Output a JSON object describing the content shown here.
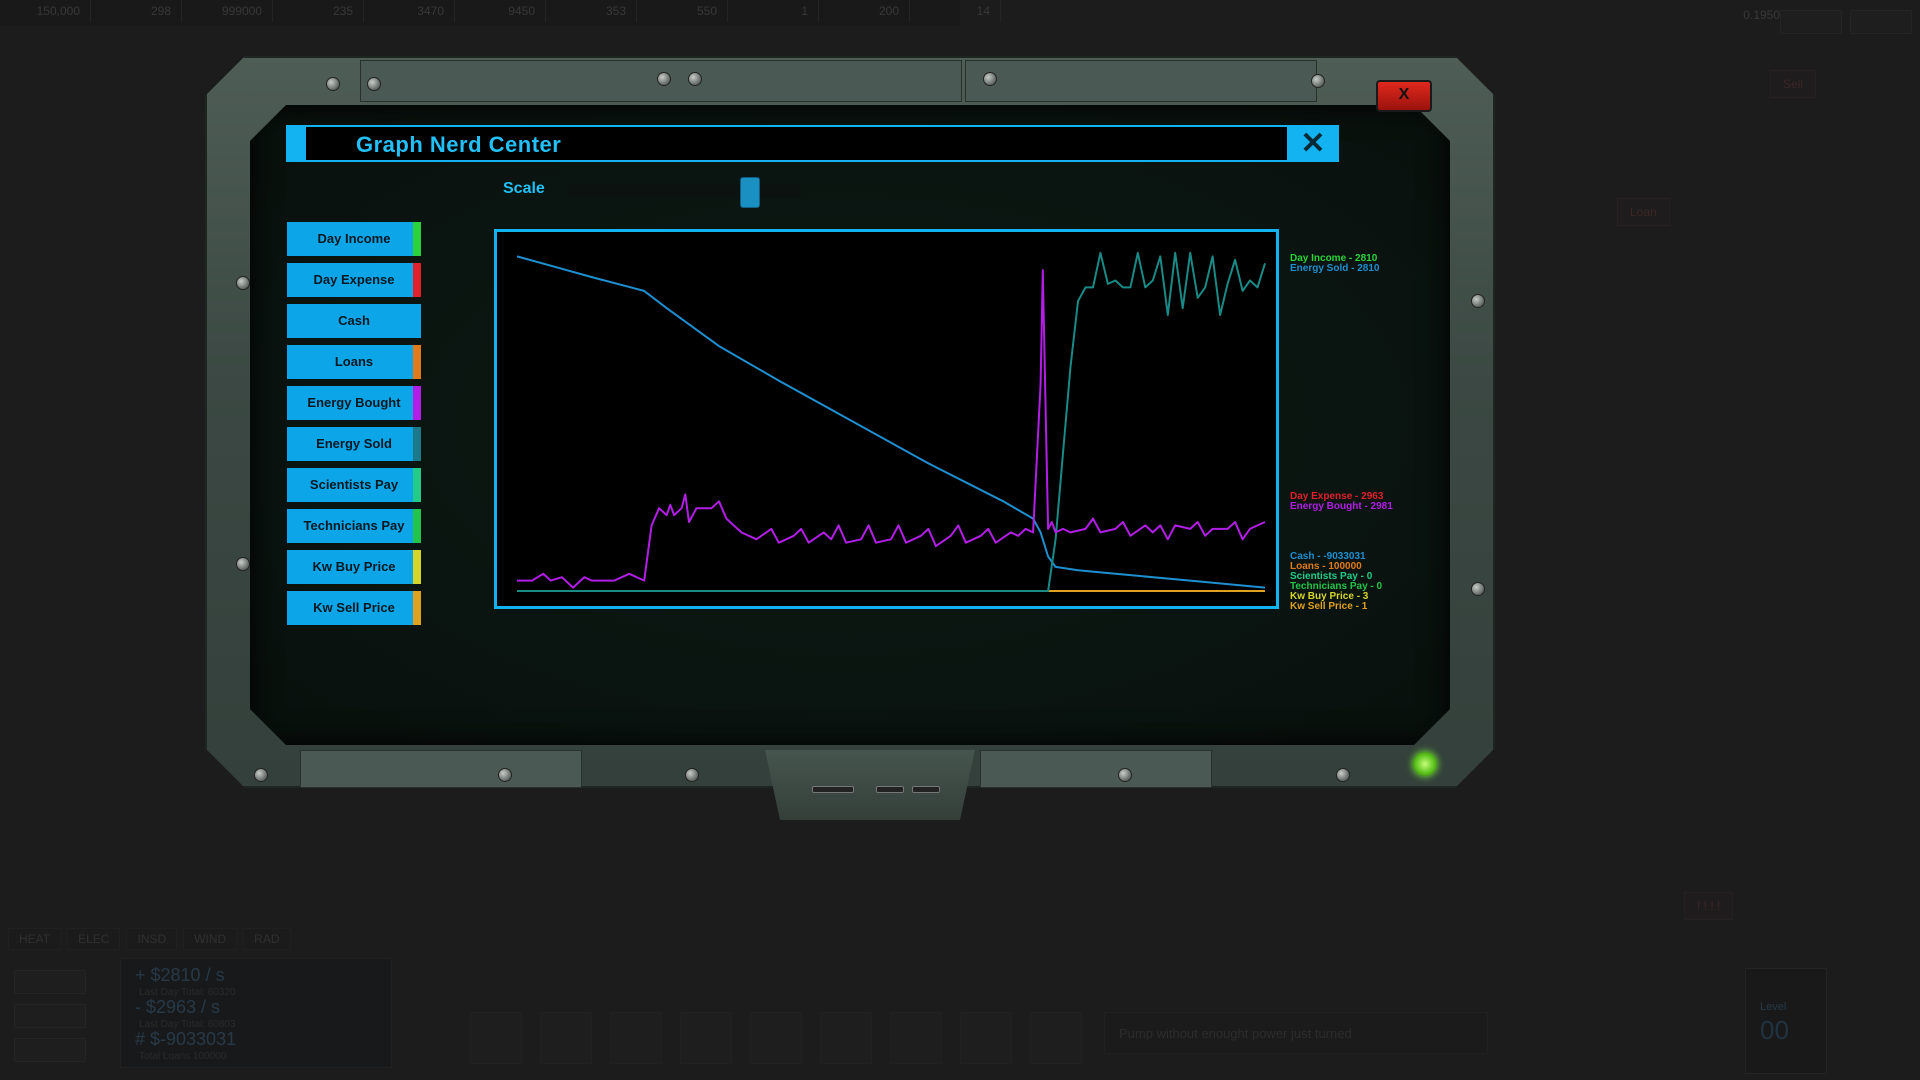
{
  "background": {
    "top_stats": [
      "150,000",
      "298",
      "999000",
      "235",
      "3470",
      "9450",
      "353",
      "550",
      "1",
      "200",
      "14"
    ],
    "bg_chips": [
      "Sell",
      "Loan",
      "! ! ! !"
    ],
    "bottom_tabs": [
      "HEAT",
      "ELEC",
      "INSD",
      "WIND",
      "RAD"
    ],
    "money": {
      "income": "+ $2810 / s",
      "income_sub": "Last Day Total: 60320",
      "expense": "- $2963 / s",
      "expense_sub": "Last Day Total: 60803",
      "cash": "# $-9033031",
      "loans_sub": "Total Loans 100000"
    },
    "message": "Pump without enought power just turned",
    "level_label": "Level",
    "level_value": "00",
    "top_right_value": "0.1950"
  },
  "window": {
    "title": "Graph Nerd Center",
    "close_icon": "x-icon",
    "frame_close_label": "X",
    "scale_label": "Scale",
    "scale_value": 0.78
  },
  "series_buttons": [
    {
      "label": "Day Income",
      "color": "#2ad33a"
    },
    {
      "label": "Day Expense",
      "color": "#e0202a"
    },
    {
      "label": "Cash",
      "color": "#0ca6e8"
    },
    {
      "label": "Loans",
      "color": "#e07a1a"
    },
    {
      "label": "Energy Bought",
      "color": "#b21ee6"
    },
    {
      "label": "Energy Sold",
      "color": "#1a7a8a"
    },
    {
      "label": "Scientists Pay",
      "color": "#22cc88"
    },
    {
      "label": "Technicians Pay",
      "color": "#22c44a"
    },
    {
      "label": "Kw Buy Price",
      "color": "#d6d62a"
    },
    {
      "label": "Kw Sell Price",
      "color": "#e0a020"
    }
  ],
  "legend": [
    {
      "text": "Day Income - 2810",
      "color": "#2ad33a",
      "group": 0
    },
    {
      "text": "Energy Sold - 2810",
      "color": "#1e8fd0",
      "group": 0
    },
    {
      "text": "Day Expense - 2963",
      "color": "#e0202a",
      "group": 1
    },
    {
      "text": "Energy Bought - 2981",
      "color": "#b21ee6",
      "group": 1
    },
    {
      "text": "Cash - -9033031",
      "color": "#1e8fd0",
      "group": 2
    },
    {
      "text": "Loans - 100000",
      "color": "#e07a1a",
      "group": 2
    },
    {
      "text": "Scientists Pay - 0",
      "color": "#22cc88",
      "group": 2
    },
    {
      "text": "Technicians Pay - 0",
      "color": "#22c44a",
      "group": 2
    },
    {
      "text": "Kw Buy Price - 3",
      "color": "#d6d62a",
      "group": 2
    },
    {
      "text": "Kw Sell Price - 1",
      "color": "#e0a020",
      "group": 2
    }
  ],
  "chart_data": {
    "type": "line",
    "title": "",
    "xlabel": "",
    "ylabel": "",
    "grid": false,
    "series": [
      {
        "name": "Cash",
        "color": "#1e8fd0",
        "points": [
          [
            0,
            0.97
          ],
          [
            0.05,
            0.94
          ],
          [
            0.1,
            0.91
          ],
          [
            0.17,
            0.87
          ],
          [
            0.2,
            0.82
          ],
          [
            0.27,
            0.71
          ],
          [
            0.35,
            0.61
          ],
          [
            0.45,
            0.49
          ],
          [
            0.55,
            0.37
          ],
          [
            0.65,
            0.26
          ],
          [
            0.69,
            0.21
          ],
          [
            0.7,
            0.17
          ],
          [
            0.71,
            0.1
          ],
          [
            0.72,
            0.07
          ],
          [
            0.75,
            0.06
          ],
          [
            0.8,
            0.05
          ],
          [
            0.9,
            0.03
          ],
          [
            1,
            0.01
          ]
        ]
      },
      {
        "name": "Energy Bought",
        "color": "#b21ee6",
        "points": [
          [
            0,
            0.03
          ],
          [
            0.02,
            0.03
          ],
          [
            0.035,
            0.05
          ],
          [
            0.045,
            0.03
          ],
          [
            0.06,
            0.04
          ],
          [
            0.075,
            0.01
          ],
          [
            0.09,
            0.04
          ],
          [
            0.1,
            0.03
          ],
          [
            0.13,
            0.03
          ],
          [
            0.15,
            0.05
          ],
          [
            0.17,
            0.03
          ],
          [
            0.18,
            0.19
          ],
          [
            0.19,
            0.24
          ],
          [
            0.2,
            0.22
          ],
          [
            0.205,
            0.25
          ],
          [
            0.21,
            0.22
          ],
          [
            0.22,
            0.24
          ],
          [
            0.225,
            0.28
          ],
          [
            0.23,
            0.2
          ],
          [
            0.24,
            0.24
          ],
          [
            0.26,
            0.24
          ],
          [
            0.27,
            0.26
          ],
          [
            0.28,
            0.21
          ],
          [
            0.3,
            0.17
          ],
          [
            0.32,
            0.15
          ],
          [
            0.34,
            0.18
          ],
          [
            0.35,
            0.14
          ],
          [
            0.37,
            0.16
          ],
          [
            0.38,
            0.18
          ],
          [
            0.39,
            0.14
          ],
          [
            0.41,
            0.17
          ],
          [
            0.42,
            0.15
          ],
          [
            0.43,
            0.19
          ],
          [
            0.44,
            0.14
          ],
          [
            0.46,
            0.15
          ],
          [
            0.47,
            0.19
          ],
          [
            0.48,
            0.14
          ],
          [
            0.5,
            0.15
          ],
          [
            0.51,
            0.19
          ],
          [
            0.52,
            0.14
          ],
          [
            0.54,
            0.16
          ],
          [
            0.55,
            0.18
          ],
          [
            0.56,
            0.13
          ],
          [
            0.58,
            0.16
          ],
          [
            0.59,
            0.19
          ],
          [
            0.6,
            0.14
          ],
          [
            0.62,
            0.16
          ],
          [
            0.63,
            0.18
          ],
          [
            0.64,
            0.14
          ],
          [
            0.66,
            0.17
          ],
          [
            0.67,
            0.16
          ],
          [
            0.68,
            0.18
          ],
          [
            0.69,
            0.17
          ],
          [
            0.7,
            0.6
          ],
          [
            0.703,
            0.93
          ],
          [
            0.706,
            0.6
          ],
          [
            0.71,
            0.18
          ],
          [
            0.715,
            0.2
          ],
          [
            0.72,
            0.17
          ],
          [
            0.73,
            0.18
          ],
          [
            0.74,
            0.17
          ],
          [
            0.76,
            0.18
          ],
          [
            0.77,
            0.21
          ],
          [
            0.78,
            0.17
          ],
          [
            0.8,
            0.18
          ],
          [
            0.81,
            0.2
          ],
          [
            0.82,
            0.16
          ],
          [
            0.84,
            0.19
          ],
          [
            0.85,
            0.17
          ],
          [
            0.86,
            0.19
          ],
          [
            0.87,
            0.15
          ],
          [
            0.88,
            0.19
          ],
          [
            0.9,
            0.18
          ],
          [
            0.91,
            0.2
          ],
          [
            0.92,
            0.16
          ],
          [
            0.93,
            0.18
          ],
          [
            0.95,
            0.18
          ],
          [
            0.96,
            0.2
          ],
          [
            0.97,
            0.15
          ],
          [
            0.98,
            0.18
          ],
          [
            0.99,
            0.19
          ],
          [
            1,
            0.2
          ]
        ]
      },
      {
        "name": "Energy Sold",
        "color": "#1a8a86",
        "points": [
          [
            0,
            0
          ],
          [
            0.69,
            0
          ],
          [
            0.71,
            0
          ],
          [
            0.72,
            0.15
          ],
          [
            0.73,
            0.4
          ],
          [
            0.74,
            0.65
          ],
          [
            0.75,
            0.84
          ],
          [
            0.76,
            0.88
          ],
          [
            0.77,
            0.88
          ],
          [
            0.78,
            0.98
          ],
          [
            0.79,
            0.89
          ],
          [
            0.8,
            0.9
          ],
          [
            0.81,
            0.88
          ],
          [
            0.82,
            0.88
          ],
          [
            0.83,
            0.98
          ],
          [
            0.84,
            0.88
          ],
          [
            0.85,
            0.9
          ],
          [
            0.86,
            0.97
          ],
          [
            0.87,
            0.8
          ],
          [
            0.88,
            0.98
          ],
          [
            0.89,
            0.82
          ],
          [
            0.9,
            0.98
          ],
          [
            0.91,
            0.85
          ],
          [
            0.92,
            0.88
          ],
          [
            0.93,
            0.97
          ],
          [
            0.94,
            0.8
          ],
          [
            0.95,
            0.89
          ],
          [
            0.96,
            0.96
          ],
          [
            0.97,
            0.87
          ],
          [
            0.98,
            0.9
          ],
          [
            0.99,
            0.88
          ],
          [
            1,
            0.95
          ]
        ]
      },
      {
        "name": "Kw Sell Price",
        "color": "#e0a020",
        "points": [
          [
            0,
            0
          ],
          [
            1,
            0
          ]
        ]
      }
    ]
  }
}
